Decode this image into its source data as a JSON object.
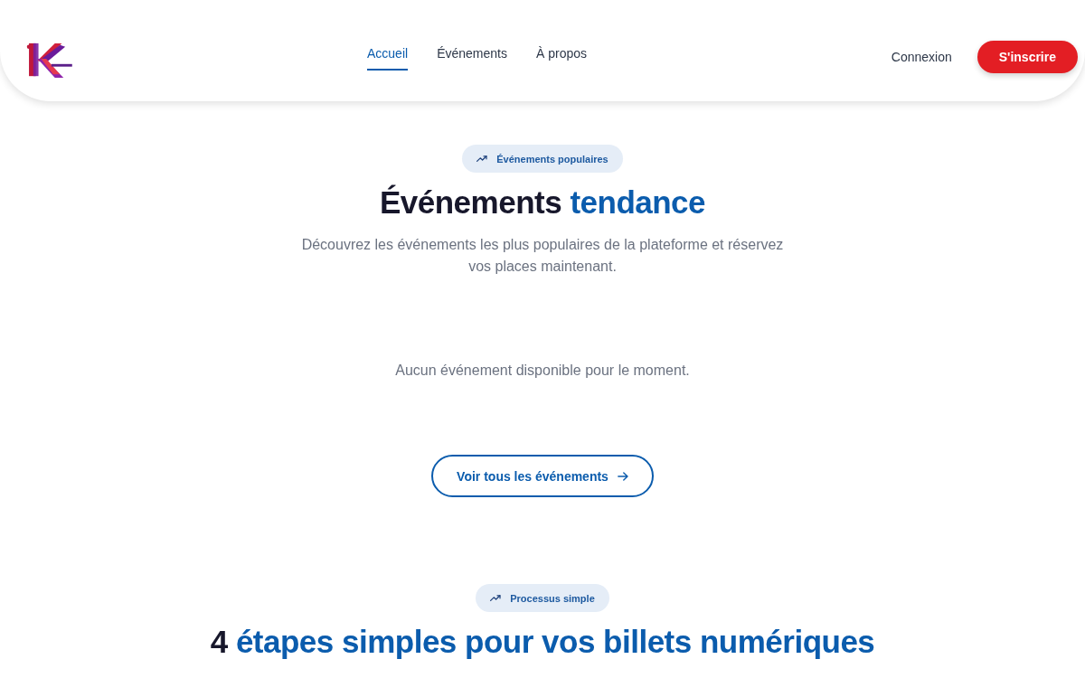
{
  "header": {
    "nav": [
      {
        "label": "Accueil",
        "selected": true
      },
      {
        "label": "Événements",
        "selected": false
      },
      {
        "label": "À propos",
        "selected": false
      }
    ],
    "login": "Connexion",
    "signup": "S'inscrire"
  },
  "trending": {
    "badge": "Événements populaires",
    "title": {
      "main": "Événements",
      "accent": "tendance"
    },
    "subtitle": "Découvrez les événements les plus populaires de la plateforme et réservez vos places maintenant.",
    "empty_message": "Aucun événement disponible pour le moment.",
    "button": "Voir tous les événements"
  },
  "process": {
    "badge": "Processus simple",
    "title": {
      "main": "4",
      "accent": "étapes simples pour vos billets numériques"
    }
  }
}
